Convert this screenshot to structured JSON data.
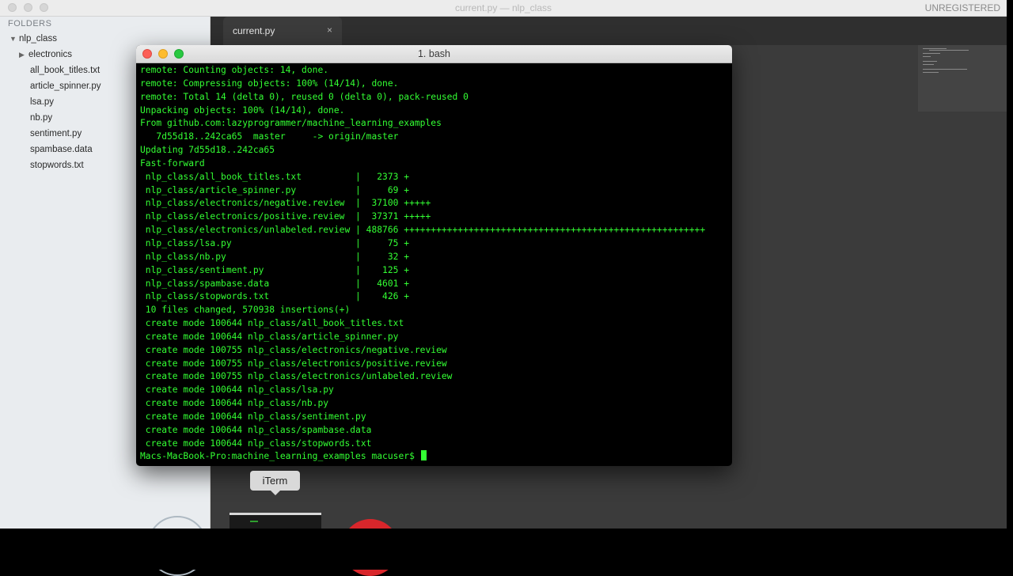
{
  "editor": {
    "title": "current.py — nlp_class",
    "unregistered": "UNREGISTERED",
    "tab": {
      "label": "current.py",
      "close": "×"
    }
  },
  "sidebar": {
    "header": "FOLDERS",
    "root": "nlp_class",
    "items": [
      {
        "label": "electronics",
        "type": "folder"
      },
      {
        "label": "all_book_titles.txt",
        "type": "file"
      },
      {
        "label": "article_spinner.py",
        "type": "file"
      },
      {
        "label": "lsa.py",
        "type": "file"
      },
      {
        "label": "nb.py",
        "type": "file"
      },
      {
        "label": "sentiment.py",
        "type": "file"
      },
      {
        "label": "spambase.data",
        "type": "file"
      },
      {
        "label": "stopwords.txt",
        "type": "file"
      }
    ]
  },
  "terminal": {
    "title": "1. bash",
    "lines": [
      "remote: Counting objects: 14, done.",
      "remote: Compressing objects: 100% (14/14), done.",
      "remote: Total 14 (delta 0), reused 0 (delta 0), pack-reused 0",
      "Unpacking objects: 100% (14/14), done.",
      "From github.com:lazyprogrammer/machine_learning_examples",
      "   7d55d18..242ca65  master     -> origin/master",
      "Updating 7d55d18..242ca65",
      "Fast-forward",
      " nlp_class/all_book_titles.txt          |   2373 +",
      " nlp_class/article_spinner.py           |     69 +",
      " nlp_class/electronics/negative.review  |  37100 +++++",
      " nlp_class/electronics/positive.review  |  37371 +++++",
      " nlp_class/electronics/unlabeled.review | 488766 ++++++++++++++++++++++++++++++++++++++++++++++++++++++++",
      " nlp_class/lsa.py                       |     75 +",
      " nlp_class/nb.py                        |     32 +",
      " nlp_class/sentiment.py                 |    125 +",
      " nlp_class/spambase.data                |   4601 +",
      " nlp_class/stopwords.txt                |    426 +",
      " 10 files changed, 570938 insertions(+)",
      " create mode 100644 nlp_class/all_book_titles.txt",
      " create mode 100644 nlp_class/article_spinner.py",
      " create mode 100755 nlp_class/electronics/negative.review",
      " create mode 100755 nlp_class/electronics/positive.review",
      " create mode 100755 nlp_class/electronics/unlabeled.review",
      " create mode 100644 nlp_class/lsa.py",
      " create mode 100644 nlp_class/nb.py",
      " create mode 100644 nlp_class/sentiment.py",
      " create mode 100644 nlp_class/spambase.data",
      " create mode 100644 nlp_class/stopwords.txt"
    ],
    "prompt": "Macs-MacBook-Pro:machine_learning_examples macuser$ "
  },
  "dock": {
    "tooltip": "iTerm"
  },
  "colors": {
    "terminal_text": "#33ff33",
    "terminal_bg": "#000000",
    "close": "#fc5f57",
    "minimize": "#fdbc2e",
    "zoom": "#28c840"
  }
}
